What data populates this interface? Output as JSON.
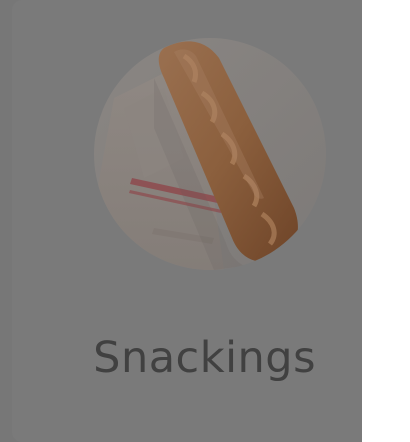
{
  "category_card": {
    "title": "Snackings",
    "image_icon": "baguette-bread-image"
  }
}
